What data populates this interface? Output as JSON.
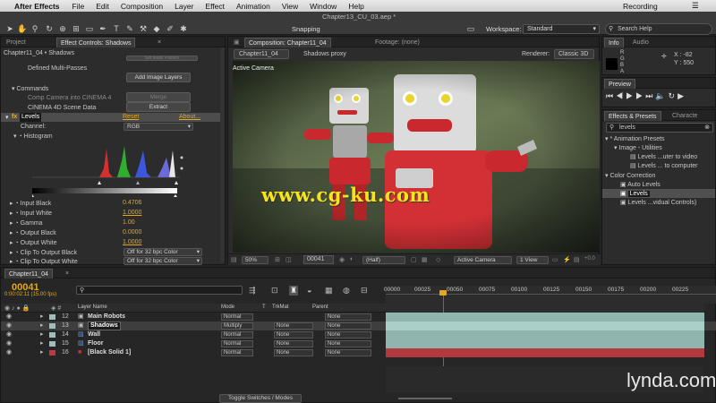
{
  "menubar": {
    "apple": "",
    "app_name": "After Effects",
    "items": [
      "File",
      "Edit",
      "Composition",
      "Layer",
      "Effect",
      "Animation",
      "View",
      "Window",
      "Help"
    ],
    "recording": "Recording"
  },
  "toolbar": {
    "file_title": "Chapter13_CU_03.aep *",
    "snapping": "Snapping",
    "workspace_label": "Workspace:",
    "workspace_value": "Standard",
    "search_help": "Search Help"
  },
  "left_panel": {
    "tabs": [
      "Project",
      "Effect Controls: Shadows"
    ],
    "breadcrumb": "Chapter11_04 • Shadows",
    "select_mask_btn": "Set Mask Passes",
    "defined_multi": "Defined Multi-Passes",
    "add_layers_btn": "Add Image Layers",
    "commands": "Commands",
    "comp_camera": "Comp Camera into CINEMA 4",
    "merge_btn": "Merge",
    "c4d_scene": "CINEMA 4D Scene Data",
    "extract_btn": "Extract",
    "fx_badge": "fx",
    "levels": "Levels",
    "reset": "Reset",
    "about": "About...",
    "channel_label": "Channel:",
    "channel_value": "RGB",
    "histogram": "Histogram",
    "params": [
      {
        "name": "Input Black",
        "value": "0.4706"
      },
      {
        "name": "Input White",
        "value": "1.0000"
      },
      {
        "name": "Gamma",
        "value": "1.00"
      },
      {
        "name": "Output Black",
        "value": "0.0000"
      },
      {
        "name": "Output White",
        "value": "1.0000"
      }
    ],
    "clip_black": "Clip To Output Black",
    "clip_black_value": "Off for 32 bpc Color",
    "clip_white": "Clip To Output White",
    "clip_white_value": "Off for 32 bpc Color"
  },
  "comp_panel": {
    "tab_comp": "Composition: Chapter11_04",
    "tab_footage": "Footage: (none)",
    "subtab": "Chapter11_04",
    "proxy": "Shadows proxy",
    "renderer_label": "Renderer:",
    "renderer_value": "Classic 3D",
    "active_camera": "Active Camera",
    "zoom": "50%",
    "frame": "00041",
    "resolution": "(Half)",
    "camera": "Active Camera",
    "views": "1 View",
    "extra": "+0.0"
  },
  "right_panel": {
    "info_tab": "Info",
    "audio_tab": "Audio",
    "info_r": "R",
    "info_g": "G",
    "info_b": "B",
    "info_a": "A",
    "info_x": "X : -82",
    "info_y": "Y : 550",
    "preview_tab": "Preview",
    "effects_tab": "Effects & Presets",
    "chars_tab": "Characte",
    "search_value": "levels",
    "tree": [
      {
        "text": "▾ * Animation Presets",
        "indent": 0
      },
      {
        "text": "▾ Image - Utilities",
        "indent": 1
      },
      {
        "text": "Levels ...uter to video",
        "indent": 2
      },
      {
        "text": "Levels ... to computer",
        "indent": 2
      },
      {
        "text": "▾ Color Correction",
        "indent": 0
      },
      {
        "text": "Auto Levels",
        "indent": 1
      },
      {
        "text": "Levels",
        "indent": 1,
        "selected": true
      },
      {
        "text": "Levels ...vidual Controls)",
        "indent": 1
      }
    ]
  },
  "timeline": {
    "tab": "Chapter11_04",
    "timecode": "00041",
    "timecode_sub": "0:00:02:11 (15.00 fps)",
    "ruler": [
      "00000",
      "00025",
      "00050",
      "00075",
      "00100",
      "00125",
      "00150",
      "00175",
      "00200",
      "00225"
    ],
    "headers": {
      "layer_name": "Layer Name",
      "mode": "Mode",
      "t": "T",
      "trkmat": "TrkMat",
      "parent": "Parent"
    },
    "layers": [
      {
        "num": "12",
        "name": "Main Robots",
        "mode": "Normal",
        "trkmat": "",
        "parent": "None",
        "color": "#9dbfbb",
        "track": "#8fb5ae"
      },
      {
        "num": "13",
        "name": "Shadows",
        "mode": "Multiply",
        "trkmat": "None",
        "parent": "None",
        "color": "#9dbfbb",
        "track": "#8fb5ae",
        "selected": true
      },
      {
        "num": "14",
        "name": "Wall",
        "mode": "Normal",
        "trkmat": "None",
        "parent": "None",
        "color": "#9dbfbb",
        "track": "#8fb5ae"
      },
      {
        "num": "15",
        "name": "Floor",
        "mode": "Normal",
        "trkmat": "None",
        "parent": "None",
        "color": "#9dbfbb",
        "track": "#8fb5ae"
      },
      {
        "num": "16",
        "name": "[Black Solid 1]",
        "mode": "Normal",
        "trkmat": "None",
        "parent": "None",
        "color": "#c4353c",
        "track": "#b23a3f"
      }
    ],
    "toggle_switches": "Toggle Switches / Modes"
  },
  "overlay": {
    "watermark": "www.cg-ku.com",
    "brand": "lynda.com"
  }
}
